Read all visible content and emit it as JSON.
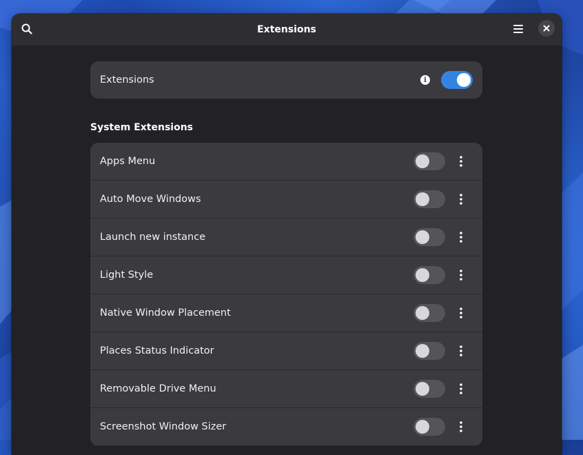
{
  "window": {
    "title": "Extensions"
  },
  "icons": {
    "search": "search-icon",
    "menu": "hamburger-menu-icon",
    "close": "close-icon",
    "info": "info-icon",
    "more": "vertical-ellipsis-icon"
  },
  "master": {
    "label": "Extensions",
    "enabled": true
  },
  "system_section": {
    "title": "System Extensions",
    "items": [
      {
        "label": "Apps Menu",
        "enabled": false
      },
      {
        "label": "Auto Move Windows",
        "enabled": false
      },
      {
        "label": "Launch new instance",
        "enabled": false
      },
      {
        "label": "Light Style",
        "enabled": false
      },
      {
        "label": "Native Window Placement",
        "enabled": false
      },
      {
        "label": "Places Status Indicator",
        "enabled": false
      },
      {
        "label": "Removable Drive Menu",
        "enabled": false
      },
      {
        "label": "Screenshot Window Sizer",
        "enabled": false
      }
    ]
  },
  "colors": {
    "accent": "#3584e4",
    "window_bg": "#222226",
    "card_bg": "#3a3a3f",
    "headerbar_bg": "#2e2e32"
  }
}
